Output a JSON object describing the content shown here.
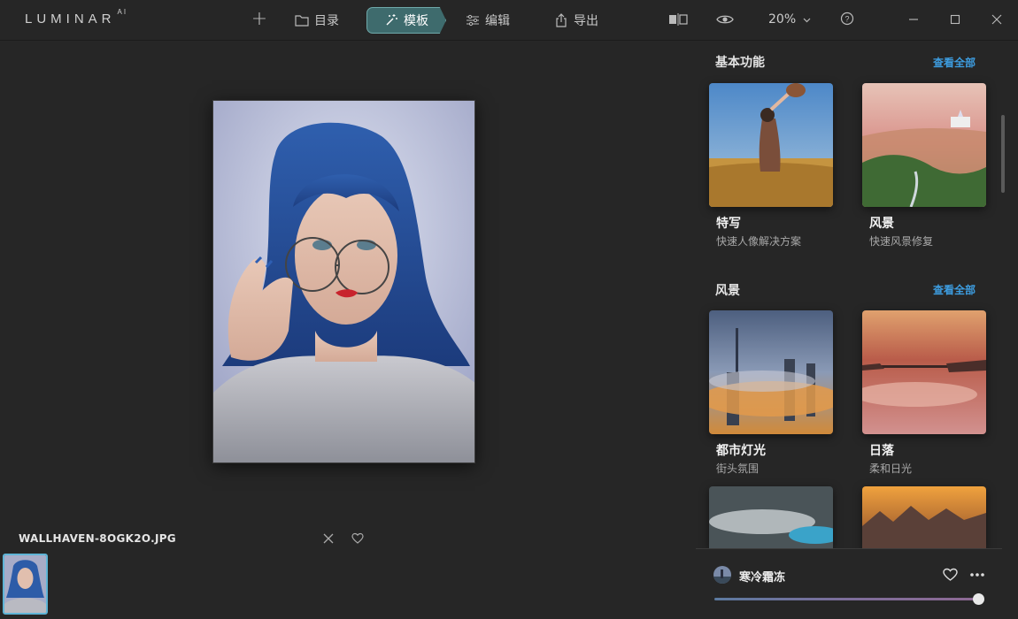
{
  "app": {
    "logo": "LUMINAR",
    "logo_suffix": "AI"
  },
  "toolbar": {
    "add_label": "+",
    "catalog_label": "目录",
    "templates_label": "模板",
    "edit_label": "编辑",
    "export_label": "导出",
    "zoom_label": "20%",
    "active_tab": "模板",
    "accent_color": "#3e6b6d",
    "icons": [
      "add-icon",
      "folder-icon",
      "magic-wand-icon",
      "sliders-icon",
      "share-icon",
      "compare-icon",
      "eye-icon",
      "chevron-down-icon",
      "help-icon",
      "minimize-icon",
      "maximize-icon",
      "close-icon"
    ]
  },
  "canvas": {
    "filename": "WALLHAVEN-8OGK2O.JPG"
  },
  "panel": {
    "sections": [
      {
        "title": "基本功能",
        "see_all": "查看全部",
        "cards": [
          {
            "name": "特写",
            "desc": "快速人像解决方案"
          },
          {
            "name": "风景",
            "desc": "快速风景修复"
          }
        ]
      },
      {
        "title": "风景",
        "see_all": "查看全部",
        "cards": [
          {
            "name": "都市灯光",
            "desc": "街头氛围"
          },
          {
            "name": "日落",
            "desc": "柔和日光"
          }
        ]
      }
    ],
    "see_all_color": "#3d9de0"
  },
  "preset": {
    "name": "寒冷霜冻",
    "amount": 1.0
  }
}
